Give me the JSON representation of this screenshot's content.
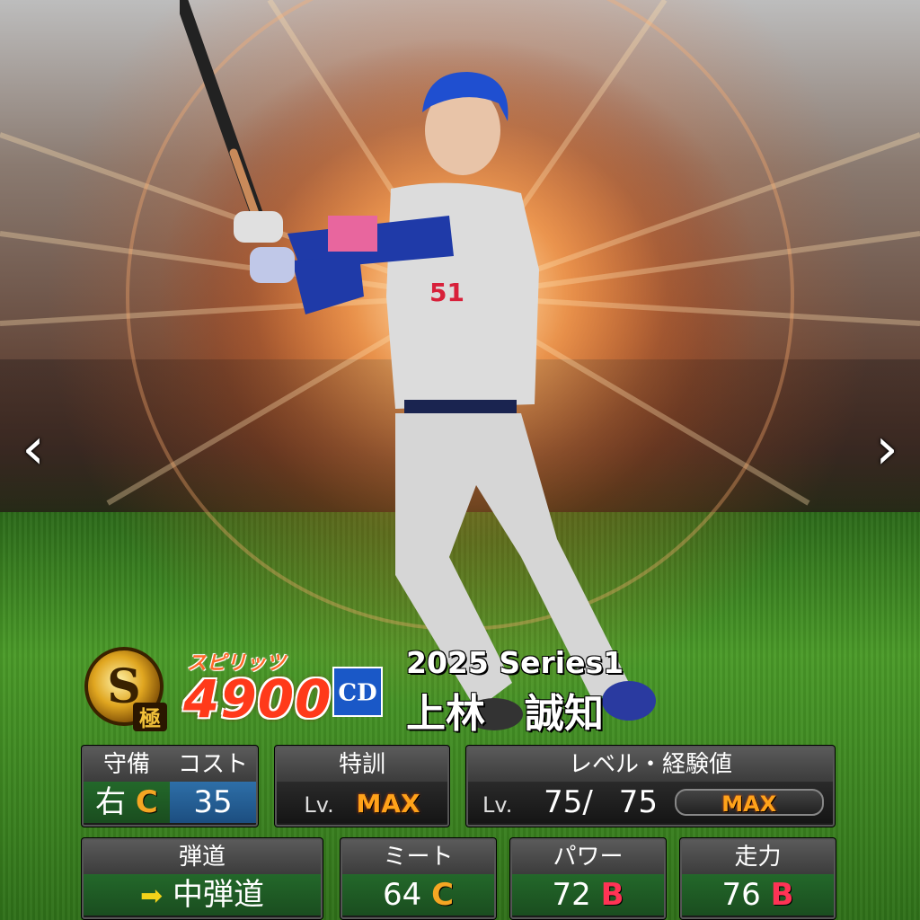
{
  "nav": {
    "prev_icon": "chevron-left-icon",
    "next_icon": "chevron-right-icon"
  },
  "card": {
    "rank_letter": "S",
    "rank_tier": "極",
    "spirits_label": "スピリッツ",
    "spirits_value": "4900",
    "team_logo_text": "CD",
    "series": "2025 Series1",
    "player_name": "上林　誠知",
    "uniform_number": "51"
  },
  "stats": {
    "defense": {
      "label": "守備",
      "hand": "右",
      "grade": "C"
    },
    "cost": {
      "label": "コスト",
      "value": "35"
    },
    "special_training": {
      "label": "特訓",
      "lv_prefix": "Lv.",
      "value": "MAX"
    },
    "level": {
      "label": "レベル・経験値",
      "lv_prefix": "Lv.",
      "current": "75",
      "separator": "/",
      "max": "75",
      "exp_label": "MAX"
    },
    "trajectory": {
      "label": "弾道",
      "value": "中弾道",
      "icon": "arrow-right-icon"
    },
    "meet": {
      "label": "ミート",
      "value": "64",
      "grade": "C"
    },
    "power": {
      "label": "パワー",
      "value": "72",
      "grade": "B"
    },
    "speed": {
      "label": "走力",
      "value": "76",
      "grade": "B"
    }
  },
  "colors": {
    "grade_c": "#f5a623",
    "grade_b": "#ff3355",
    "spirits": "#ff3a1a",
    "team_blue": "#1a58c7"
  }
}
